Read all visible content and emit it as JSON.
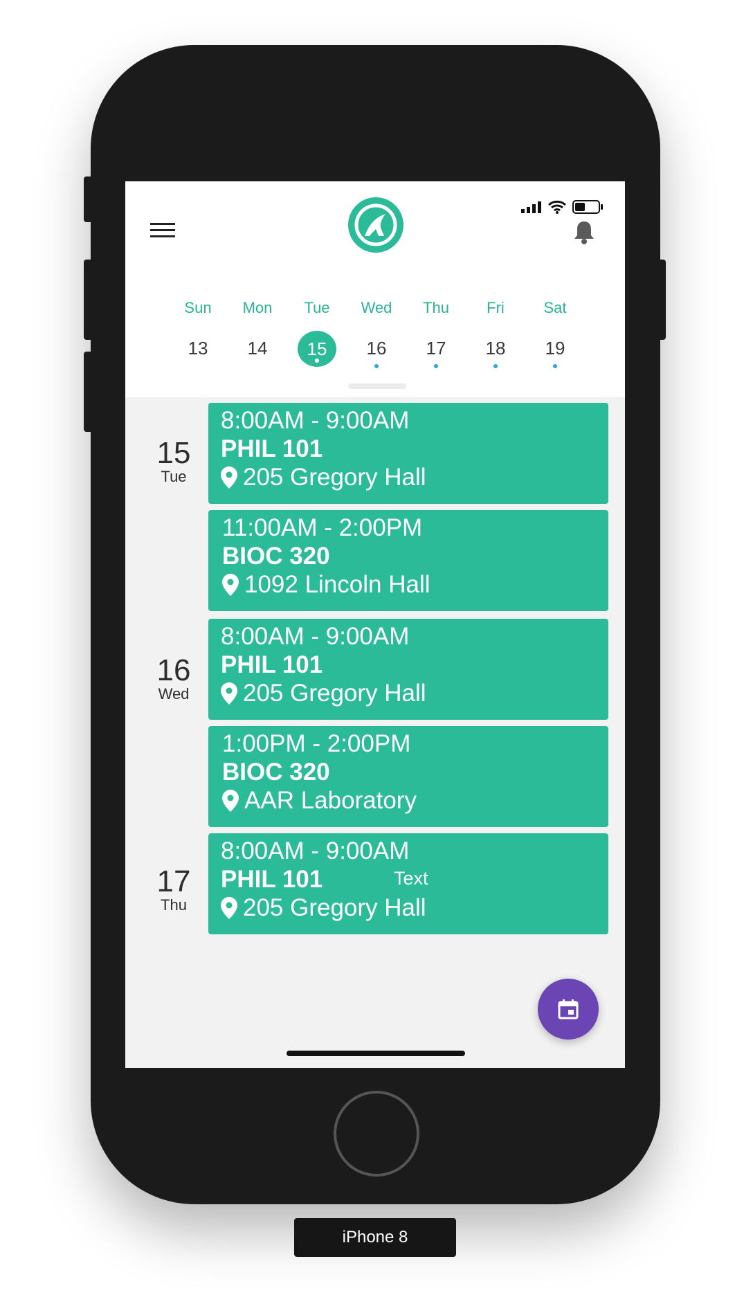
{
  "status_bar": {
    "icons": [
      "signal-icon",
      "wifi-icon",
      "battery-icon"
    ]
  },
  "header": {
    "menu_icon": "hamburger-menu-icon",
    "logo_icon": "app-logo-icon",
    "notification_icon": "bell-icon"
  },
  "week": {
    "days": [
      {
        "name": "Sun",
        "num": "13",
        "has_events": false,
        "selected": false
      },
      {
        "name": "Mon",
        "num": "14",
        "has_events": false,
        "selected": false
      },
      {
        "name": "Tue",
        "num": "15",
        "has_events": true,
        "selected": true
      },
      {
        "name": "Wed",
        "num": "16",
        "has_events": true,
        "selected": false
      },
      {
        "name": "Thu",
        "num": "17",
        "has_events": true,
        "selected": false
      },
      {
        "name": "Fri",
        "num": "18",
        "has_events": true,
        "selected": false
      },
      {
        "name": "Sat",
        "num": "19",
        "has_events": true,
        "selected": false
      }
    ]
  },
  "agenda": {
    "groups": [
      {
        "num": "15",
        "weekday": "Tue"
      },
      {
        "num": "16",
        "weekday": "Wed"
      },
      {
        "num": "17",
        "weekday": "Thu"
      }
    ],
    "events": [
      {
        "time": "8:00AM - 9:00AM",
        "course": "PHIL 101",
        "location": "205 Gregory Hall"
      },
      {
        "time": "11:00AM - 2:00PM",
        "course": "BIOC 320",
        "location": "1092 Lincoln Hall"
      },
      {
        "time": "8:00AM - 9:00AM",
        "course": "PHIL 101",
        "location": "205 Gregory Hall"
      },
      {
        "time": "1:00PM - 2:00PM",
        "course": "BIOC 320",
        "location": "AAR Laboratory"
      },
      {
        "time": "8:00AM - 9:00AM",
        "course": "PHIL 101",
        "location": "205 Gregory Hall",
        "note": "Text"
      }
    ]
  },
  "fab": {
    "icon": "calendar-icon"
  },
  "device": {
    "label": "iPhone 8"
  },
  "colors": {
    "accent": "#2bbb99",
    "fab": "#6a45b3",
    "event_dot": "#2aa7d8"
  }
}
